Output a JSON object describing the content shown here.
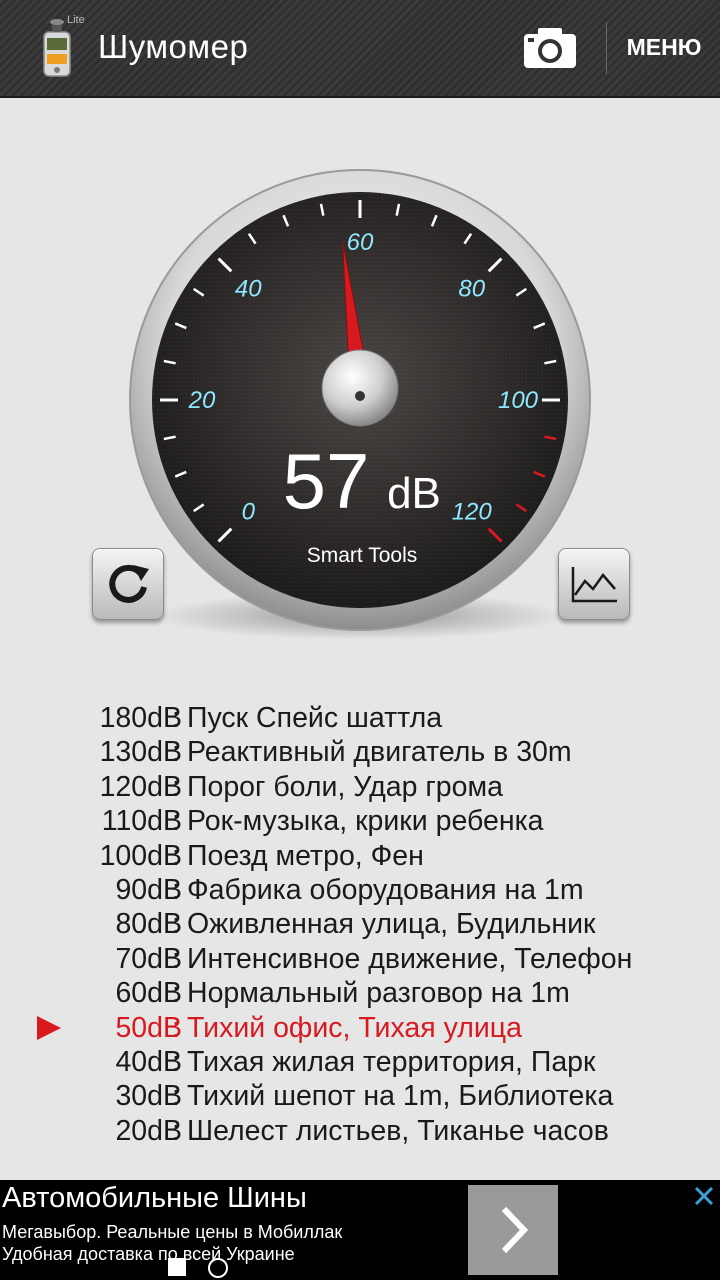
{
  "app": {
    "title": "Шумомер",
    "badge": "Lite",
    "menu_label": "МЕНЮ",
    "camera_icon": "camera-icon"
  },
  "gauge": {
    "reading_value": "57",
    "reading_unit": "dB",
    "brand": "Smart Tools",
    "scale_labels": [
      "0",
      "20",
      "40",
      "60",
      "80",
      "100",
      "120"
    ],
    "needle_value": 57,
    "scale_min": 0,
    "scale_max": 120,
    "accent_color": "#d71920",
    "label_color": "#8ee8ff"
  },
  "buttons": {
    "reset_icon": "refresh-icon",
    "graph_icon": "line-graph-icon"
  },
  "reference": [
    {
      "db": "180dB",
      "desc": "Пуск Спейс шаттла"
    },
    {
      "db": "130dB",
      "desc": "Реактивный двигатель в 30m"
    },
    {
      "db": "120dB",
      "desc": "Порог боли, Удар грома"
    },
    {
      "db": "110dB",
      "desc": "Рок-музыка, крики ребенка"
    },
    {
      "db": "100dB",
      "desc": "Поезд метро, Фен"
    },
    {
      "db": "90dB",
      "desc": "Фабрика оборудования на 1m"
    },
    {
      "db": "80dB",
      "desc": "Оживленная улица, Будильник"
    },
    {
      "db": "70dB",
      "desc": "Интенсивное движение, Телефон"
    },
    {
      "db": "60dB",
      "desc": "Нормальный разговор на 1m"
    },
    {
      "db": "50dB",
      "desc": "Тихий офис, Тихая улица",
      "active": true
    },
    {
      "db": "40dB",
      "desc": "Тихая жилая территория, Парк"
    },
    {
      "db": "30dB",
      "desc": "Тихий шепот на 1m, Библиотека"
    },
    {
      "db": "20dB",
      "desc": "Шелест листьев, Тиканье часов"
    }
  ],
  "ad": {
    "title": "Автомобильные Шины",
    "line1": "Мегавыбор. Реальные цены в Мобиллак",
    "line2": "Удобная доставка по всей Украине",
    "arrow_icon": "chevron-right-icon",
    "close_icon": "close-icon"
  }
}
